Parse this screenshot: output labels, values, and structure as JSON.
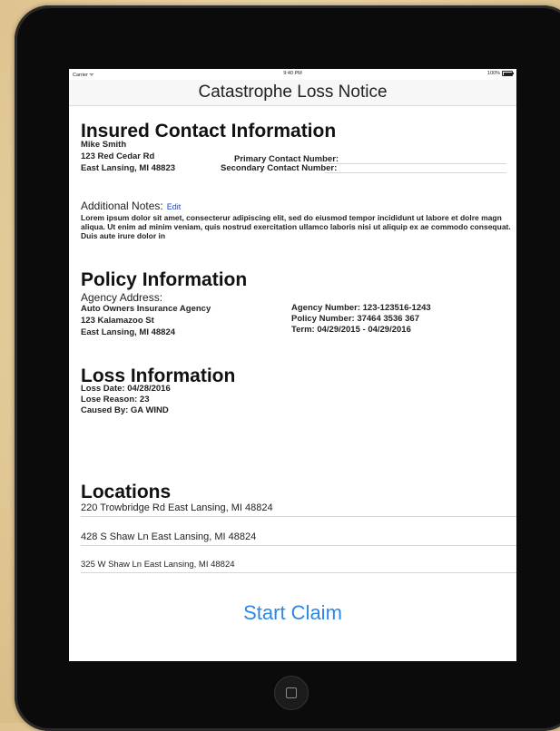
{
  "status_bar": {
    "carrier": "Carrier ᯤ",
    "time": "9:40 PM",
    "battery": "100%"
  },
  "nav": {
    "title": "Catastrophe Loss Notice"
  },
  "insured": {
    "heading": "Insured Contact Information",
    "name": "Mike Smith",
    "street": "123 Red Cedar Rd",
    "city": "East Lansing, MI 48823",
    "primary_label": "Primary Contact Number:",
    "secondary_label": "Secondary Contact Number:"
  },
  "notes": {
    "label": "Additional Notes:",
    "edit": "Edit",
    "body": "Lorem ipsum dolor sit amet, consecterur adipiscing elit, sed do eiusmod tempor incididunt ut labore et dolre magn aliqua. Ut enim ad minim veniam, quis nostrud exercitation ullamco laboris nisi ut aliquip ex ae commodo consequat. Duis aute irure dolor in"
  },
  "policy": {
    "heading": "Policy Information",
    "agency_address_label": "Agency Address:",
    "agency_name": "Auto Owners Insurance Agency",
    "agency_street": "123 Kalamazoo St",
    "agency_city": "East Lansing, MI 48824",
    "agency_number": "Agency Number: 123-123516-1243",
    "policy_number": "Policy Number: 37464 3536 367",
    "term": "Term: 04/29/2015 - 04/29/2016"
  },
  "loss": {
    "heading": "Loss Information",
    "date": "Loss Date: 04/28/2016",
    "reason": "Lose Reason: 23",
    "caused_by": "Caused By: GA WIND"
  },
  "locations": {
    "heading": "Locations",
    "items": [
      "220 Trowbridge Rd East Lansing, MI 48824",
      "428 S Shaw Ln East Lansing, MI 48824",
      "325 W Shaw Ln East Lansing, MI 48824"
    ]
  },
  "actions": {
    "start_claim": "Start Claim"
  },
  "icons": {
    "wifi": "wifi-icon",
    "battery": "battery-icon",
    "home": "home-button-icon"
  },
  "colors": {
    "accent": "#2f87e6",
    "edit_link": "#1a46d8",
    "background": "#e8d2a6",
    "bezel": "#0b0b0b"
  }
}
